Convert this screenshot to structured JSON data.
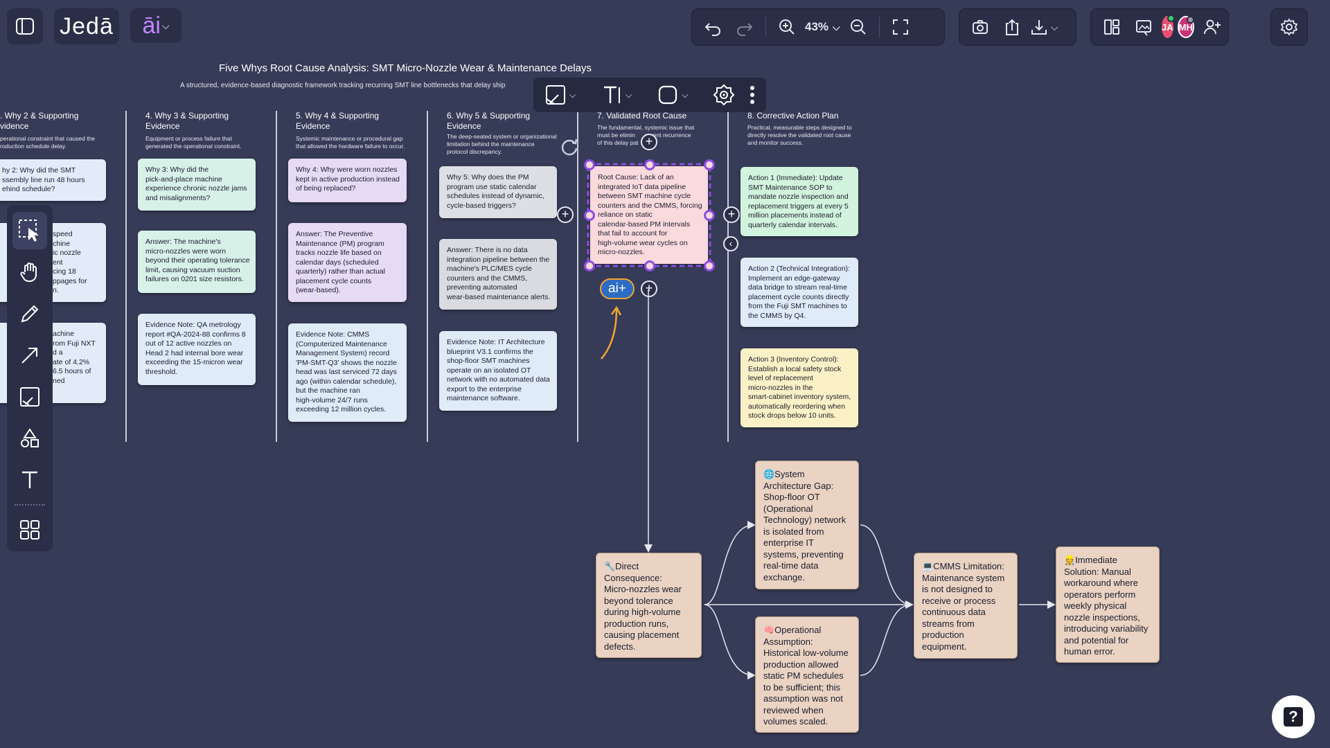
{
  "app": {
    "logo_text": "Jedā",
    "ai_label": "āi",
    "zoom": "43%"
  },
  "users": [
    {
      "initials": "JA",
      "color": "#e84f72",
      "status": "#3ccf62"
    },
    {
      "initials": "MH",
      "color": "#c8337a",
      "status": "#9a9aa6"
    }
  ],
  "board": {
    "title": "Five Whys Root Cause Analysis: SMT Micro-Nozzle Wear & Maintenance Delays",
    "subtitle": "A structured, evidence-based diagnostic framework tracking recurring SMT line bottlenecks that delay ship"
  },
  "columns": [
    {
      "head": ". Why 2 & Supporting\nvidence",
      "desc": "perational constraint that caused the\nroduction schedule delay."
    },
    {
      "head": "4. Why 3 & Supporting\nEvidence",
      "desc": "Equipment or process failure that\ngenerated the operational constraint."
    },
    {
      "head": "5. Why 4 & Supporting\nEvidence",
      "desc": "Systemic maintenance or procedural gap\nthat allowed the hardware failure to occur."
    },
    {
      "head": "6. Why 5 & Supporting\nEvidence",
      "desc": "The deep-seated system or organizational\nlimitation behind the maintenance\nprotocol discrepancy."
    },
    {
      "head": "7. Validated Root Cause",
      "desc": "The fundamental, systemic issue that\nmust be elimin      revent recurrence\nof this delay pat"
    },
    {
      "head": "8. Corrective Action Plan",
      "desc": "Practical, measurable steps designed to\ndirectly resolve the validated root cause\nand monitor success."
    }
  ],
  "notes": {
    "c1a": "hy 2: Why did the SMT\nssembly line run 48 hours\nehind schedule?",
    "c1b": "speed\nchine\nic nozzle\nent\ncing 18\nppages for\nn.",
    "c1c": "achine\nrom Fuji NXT\nd a\nate of 4.2%\n6.5 hours of\nned",
    "c2a": "Why 3: Why did the\npick-and-place machine\nexperience chronic nozzle jams\nand misalignments?",
    "c2b": "Answer: The machine's\nmicro-nozzles were worn\nbeyond their operating tolerance\nlimit, causing vacuum suction\nfailures on 0201 size resistors.",
    "c2c": "Evidence Note: QA metrology\nreport #QA-2024-88 confirms 8\nout of 12 active nozzles on\nHead 2 had internal bore wear\nexceeding the 15-micron wear\nthreshold.",
    "c3a": "Why 4: Why were worn nozzles\nkept in active production instead\nof being replaced?",
    "c3b": "Answer: The Preventive\nMaintenance (PM) program\ntracks nozzle life based on\ncalendar days (scheduled\nquarterly) rather than actual\nplacement cycle counts\n(wear-based).",
    "c3c": "Evidence Note: CMMS\n(Computerized Maintenance\nManagement System) record\n'PM-SMT-Q3' shows the nozzle\nhead was last serviced 72 days\nago (within calendar schedule),\nbut the machine ran\nhigh-volume 24/7 runs\nexceeding 12 million cycles.",
    "c4a": "Why 5: Why does the PM\nprogram use static calendar\nschedules instead of dynamic,\ncycle-based triggers?",
    "c4b": "Answer: There is no data\nintegration pipeline between the\nmachine's PLC/MES cycle\ncounters and the CMMS,\npreventing automated\nwear-based maintenance alerts.",
    "c4c": "Evidence Note: IT Architecture\nblueprint V3.1 confirms the\nshop-floor SMT machines\noperate on an isolated OT\nnetwork with no automated data\nexport to the enterprise\nmaintenance software.",
    "root": "Root Cause: Lack of an\nintegrated IoT data pipeline\nbetween SMT machine cycle\ncounters and the CMMS, forcing\nreliance on static\ncalendar-based PM intervals\nthat fail to account for\nhigh-volume wear cycles on\nmicro-nozzles.",
    "a1": "Action 1 (Immediate): Update\nSMT Maintenance SOP to\nmandate nozzle inspection and\nreplacement triggers at every 5\nmillion placements instead of\nquarterly calendar intervals.",
    "a2": "Action 2 (Technical Integration):\nImplement an edge-gateway\ndata bridge to stream real-time\nplacement cycle counts directly\nfrom the Fuji SMT machines to\nthe CMMS by Q4.",
    "a3": "Action 3 (Inventory Control):\nEstablish a local safety stock\nlevel of replacement\nmicro-nozzles in the\nsmart-cabinet inventory system,\nautomatically reordering when\nstock drops below 10 units.",
    "direct": "🔧Direct\nConsequence:\nMicro-nozzles wear\nbeyond tolerance\nduring high-volume\nproduction runs,\ncausing placement\ndefects.",
    "sysgap": "🌐System\nArchitecture Gap:\nShop-floor OT\n(Operational\nTechnology) network\nis isolated from\nenterprise IT\nsystems, preventing\nreal-time data\nexchange.",
    "opassume": "🧠Operational\nAssumption:\nHistorical low-volume\nproduction allowed\nstatic PM schedules\nto be sufficient; this\nassumption was not\nreviewed when\nvolumes scaled.",
    "cmms": "💻CMMS Limitation:\nMaintenance system\nis not designed to\nreceive or process\ncontinuous data\nstreams from\nproduction\nequipment.",
    "immediate": "👷Immediate\nSolution: Manual\nworkaround where\noperators perform\nweekly physical\nnozzle inspections,\nintroducing variability\nand potential for\nhuman error."
  },
  "float_toolbar": {
    "ai_plus": "ai+"
  },
  "help": {
    "label": "?"
  }
}
